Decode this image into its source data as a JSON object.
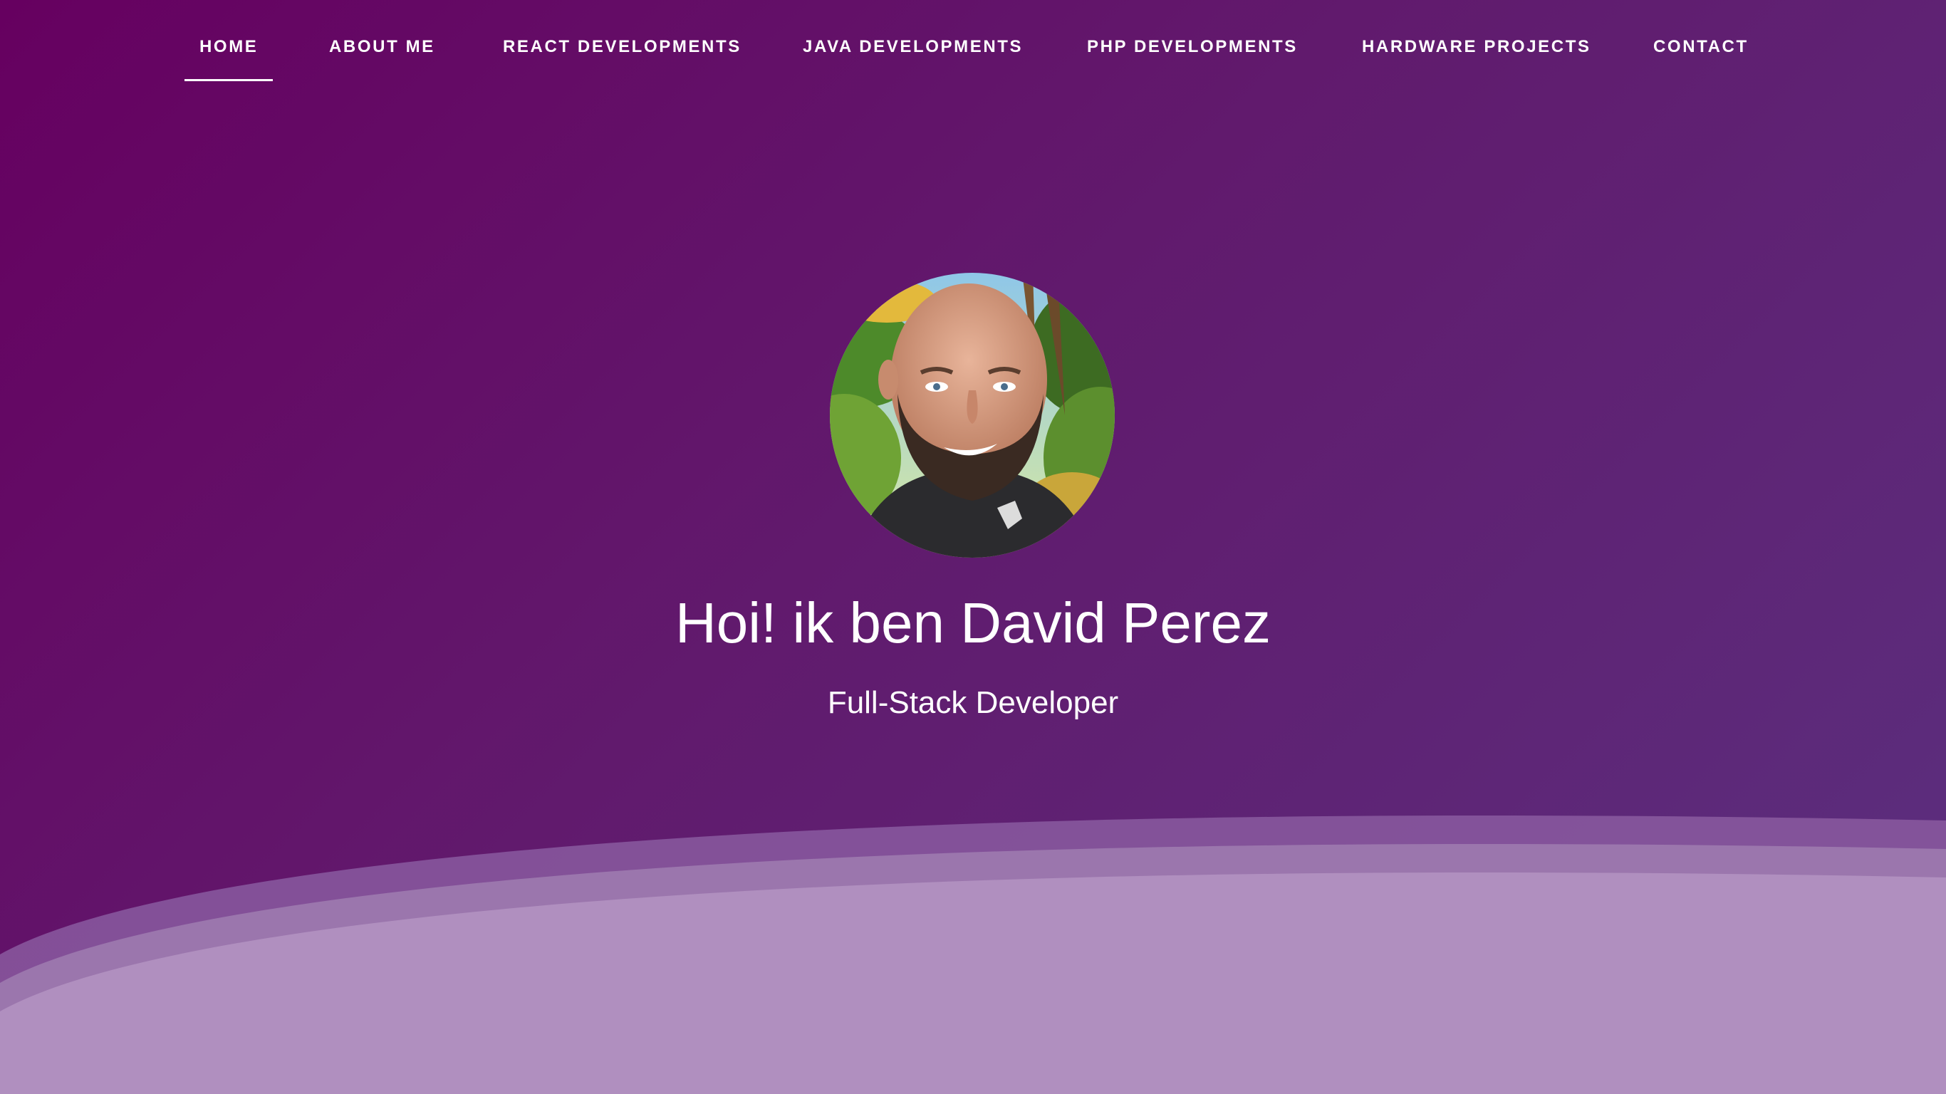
{
  "nav": {
    "items": [
      {
        "label": "HOME",
        "active": true
      },
      {
        "label": "ABOUT ME",
        "active": false
      },
      {
        "label": "REACT DEVELOPMENTS",
        "active": false
      },
      {
        "label": "JAVA DEVELOPMENTS",
        "active": false
      },
      {
        "label": "PHP DEVELOPMENTS",
        "active": false
      },
      {
        "label": "HARDWARE PROJECTS",
        "active": false
      },
      {
        "label": "CONTACT",
        "active": false
      }
    ]
  },
  "hero": {
    "title": "Hoi! ik ben David Perez",
    "subtitle": "Full-Stack Developer",
    "avatar_icon": "profile-photo"
  },
  "colors": {
    "background_start": "#660060",
    "background_end": "#5b307f",
    "wave_front": "#b08fbf",
    "text": "#ffffff"
  }
}
